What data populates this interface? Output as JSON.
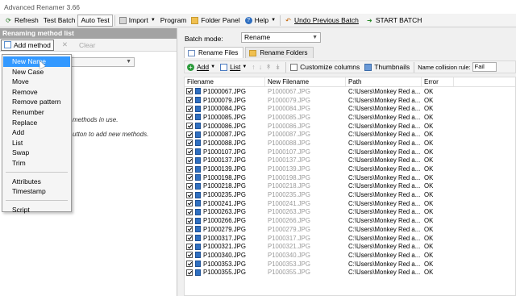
{
  "window": {
    "title": "Advanced Renamer 3.66"
  },
  "toolbar": {
    "refresh": "Refresh",
    "test_batch": "Test Batch",
    "auto_test": "Auto Test",
    "import": "Import",
    "program": "Program",
    "folder_panel": "Folder Panel",
    "help": "Help",
    "undo": "Undo Previous Batch",
    "start": "START BATCH"
  },
  "left_panel": {
    "header": "Renaming method list",
    "add_method": "Add method",
    "clear": "Clear",
    "msg_1": "methods in use.",
    "msg_2": "utton to add new methods."
  },
  "add_method_menu": {
    "items": [
      "New Name",
      "New Case",
      "Move",
      "Remove",
      "Remove pattern",
      "Renumber",
      "Replace",
      "Add",
      "List",
      "Swap",
      "Trim"
    ],
    "group2": [
      "Attributes",
      "Timestamp"
    ],
    "group3": [
      "Script"
    ],
    "highlighted": "New Name"
  },
  "right_panel": {
    "batch_mode_label": "Batch mode:",
    "batch_mode_value": "Rename",
    "tabs": [
      "Rename Files",
      "Rename Folders"
    ],
    "grid_toolbar": {
      "add": "Add",
      "list": "List",
      "customize": "Customize columns",
      "thumbnails": "Thumbnails",
      "collision_label": "Name collision rule:",
      "collision_value": "Fail"
    },
    "columns": [
      "Filename",
      "New Filename",
      "Path",
      "Error"
    ],
    "path_value": "C:\\Users\\Monkey Red a...",
    "error_value": "OK",
    "files": [
      "P1000067.JPG",
      "P1000079.JPG",
      "P1000084.JPG",
      "P1000085.JPG",
      "P1000086.JPG",
      "P1000087.JPG",
      "P1000088.JPG",
      "P1000107.JPG",
      "P1000137.JPG",
      "P1000139.JPG",
      "P1000198.JPG",
      "P1000218.JPG",
      "P1000235.JPG",
      "P1000241.JPG",
      "P1000263.JPG",
      "P1000266.JPG",
      "P1000279.JPG",
      "P1000317.JPG",
      "P1000321.JPG",
      "P1000340.JPG",
      "P1000353.JPG",
      "P1000355.JPG"
    ]
  },
  "colors": {
    "highlight": "#3399ff",
    "pane_header": "#a3a3a3",
    "new_filename": "#9a9a9a"
  }
}
